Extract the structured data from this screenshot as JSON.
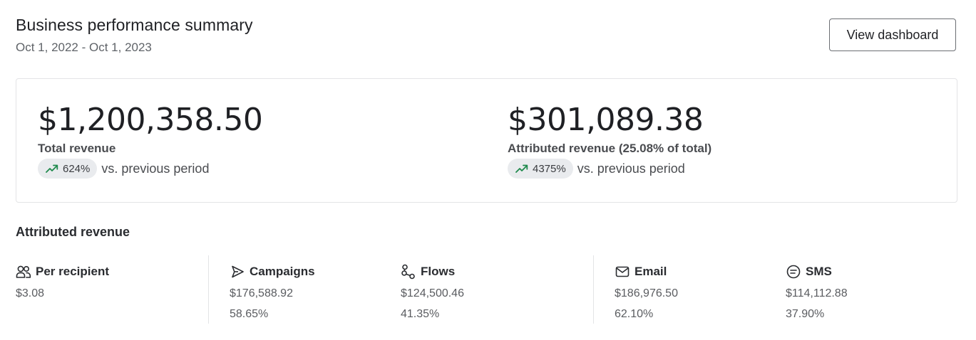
{
  "header": {
    "title": "Business performance summary",
    "date_range": "Oct 1, 2022 - Oct 1, 2023",
    "view_button_label": "View dashboard"
  },
  "summary": {
    "total": {
      "amount": "$1,200,358.50",
      "label": "Total revenue",
      "change": "624%",
      "change_icon": "trend-up-icon",
      "vs_text": "vs. previous period"
    },
    "attributed": {
      "amount": "$301,089.38",
      "label": "Attributed revenue (25.08% of total)",
      "change": "4375%",
      "change_icon": "trend-up-icon",
      "vs_text": "vs. previous period"
    },
    "trend_color": "#1f8a4c"
  },
  "attributed_section": {
    "title": "Attributed revenue",
    "stats": [
      {
        "icon": "users-icon",
        "label": "Per recipient",
        "value": "$3.08",
        "percent": ""
      },
      {
        "icon": "send-icon",
        "label": "Campaigns",
        "value": "$176,588.92",
        "percent": "58.65%"
      },
      {
        "icon": "flow-icon",
        "label": "Flows",
        "value": "$124,500.46",
        "percent": "41.35%"
      },
      {
        "icon": "mail-icon",
        "label": "Email",
        "value": "$186,976.50",
        "percent": "62.10%"
      },
      {
        "icon": "sms-icon",
        "label": "SMS",
        "value": "$114,112.88",
        "percent": "37.90%"
      }
    ]
  }
}
